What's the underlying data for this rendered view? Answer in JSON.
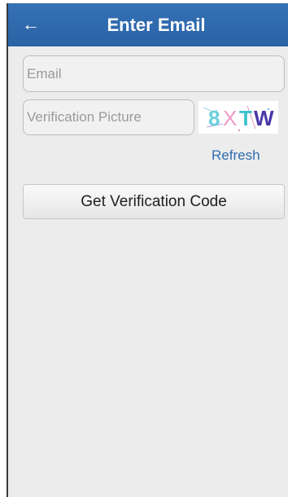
{
  "header": {
    "title": "Enter Email",
    "back_icon": "back-arrow-icon",
    "bar_color": "#2f69ad"
  },
  "form": {
    "email_placeholder": "Email",
    "verification_placeholder": "Verification Picture",
    "captcha_text": "8XTW",
    "refresh_label": "Refresh",
    "submit_label": "Get Verification Code"
  },
  "colors": {
    "background": "#ececec",
    "link": "#2f6db0",
    "placeholder": "#9a9a9a"
  }
}
